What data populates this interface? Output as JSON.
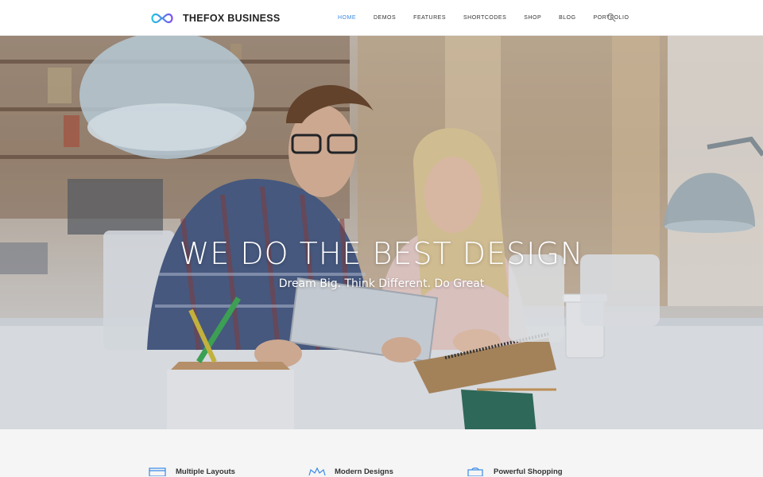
{
  "brand": {
    "name": "THEFOX BUSINESS",
    "logo_icon": "infinity-logo-icon",
    "gradient": [
      "#22c5e2",
      "#7b4ff0"
    ]
  },
  "nav": {
    "items": [
      {
        "label": "HOME",
        "active": true
      },
      {
        "label": "DEMOS",
        "active": false
      },
      {
        "label": "FEATURES",
        "active": false
      },
      {
        "label": "SHORTCODES",
        "active": false
      },
      {
        "label": "SHOP",
        "active": false
      },
      {
        "label": "BLOG",
        "active": false
      },
      {
        "label": "PORTFOLIO",
        "active": false
      }
    ],
    "search_icon": "search-icon",
    "active_color": "#3a8ae6"
  },
  "hero": {
    "title": "WE DO THE BEST DESIGN",
    "subtitle": "Dream Big. Think Different. Do Great"
  },
  "features": {
    "items": [
      {
        "label": "Multiple Layouts",
        "icon": "layouts-icon"
      },
      {
        "label": "Modern Designs",
        "icon": "crown-icon"
      },
      {
        "label": "Powerful Shopping",
        "icon": "shopping-icon"
      }
    ]
  }
}
